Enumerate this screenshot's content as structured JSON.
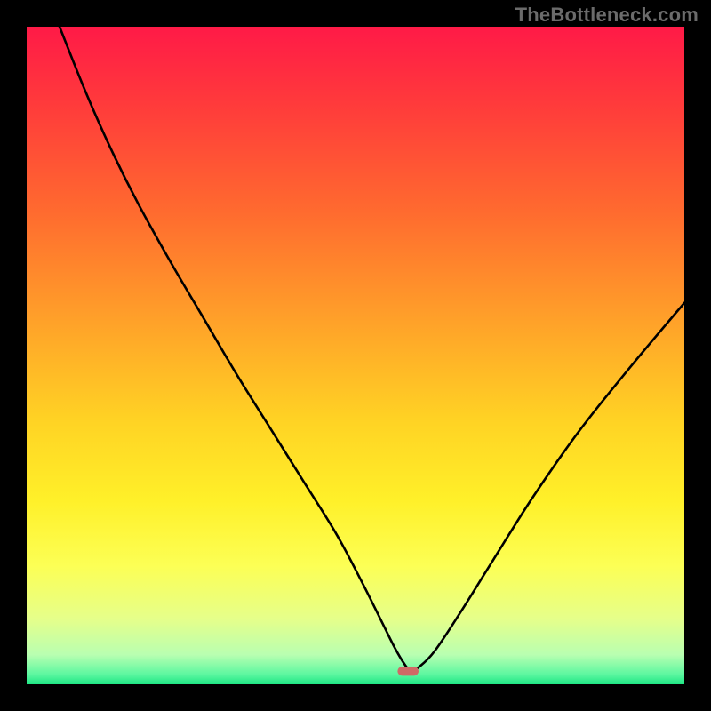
{
  "watermark": "TheBottleneck.com",
  "chart_data": {
    "type": "line",
    "title": "",
    "xlabel": "",
    "ylabel": "",
    "xlim": [
      0,
      100
    ],
    "ylim": [
      0,
      100
    ],
    "grid": false,
    "legend": false,
    "gradient_stops": [
      {
        "offset": 0.0,
        "color": "#ff1a47"
      },
      {
        "offset": 0.12,
        "color": "#ff3b3b"
      },
      {
        "offset": 0.28,
        "color": "#ff6a2f"
      },
      {
        "offset": 0.45,
        "color": "#ffa229"
      },
      {
        "offset": 0.6,
        "color": "#ffd324"
      },
      {
        "offset": 0.72,
        "color": "#fff029"
      },
      {
        "offset": 0.82,
        "color": "#fcff55"
      },
      {
        "offset": 0.9,
        "color": "#e6ff8a"
      },
      {
        "offset": 0.955,
        "color": "#b9ffb1"
      },
      {
        "offset": 0.985,
        "color": "#5cf7a0"
      },
      {
        "offset": 1.0,
        "color": "#1ee684"
      }
    ],
    "series": [
      {
        "name": "bottleneck-curve",
        "x": [
          5,
          9,
          13,
          17,
          22,
          27,
          32,
          37,
          42,
          47,
          51,
          54,
          56,
          57.5,
          58.5,
          59.5,
          62,
          66,
          71,
          77,
          84,
          92,
          100
        ],
        "y": [
          100,
          90,
          81,
          73,
          64,
          55.5,
          47,
          39,
          31,
          23,
          15.5,
          9.5,
          5.5,
          3,
          2,
          2.5,
          5,
          11,
          19,
          28.5,
          38.5,
          48.5,
          58
        ]
      }
    ],
    "marker": {
      "x": 58,
      "y": 2,
      "width": 3.2,
      "height": 1.4,
      "color": "#cf6a66"
    }
  }
}
